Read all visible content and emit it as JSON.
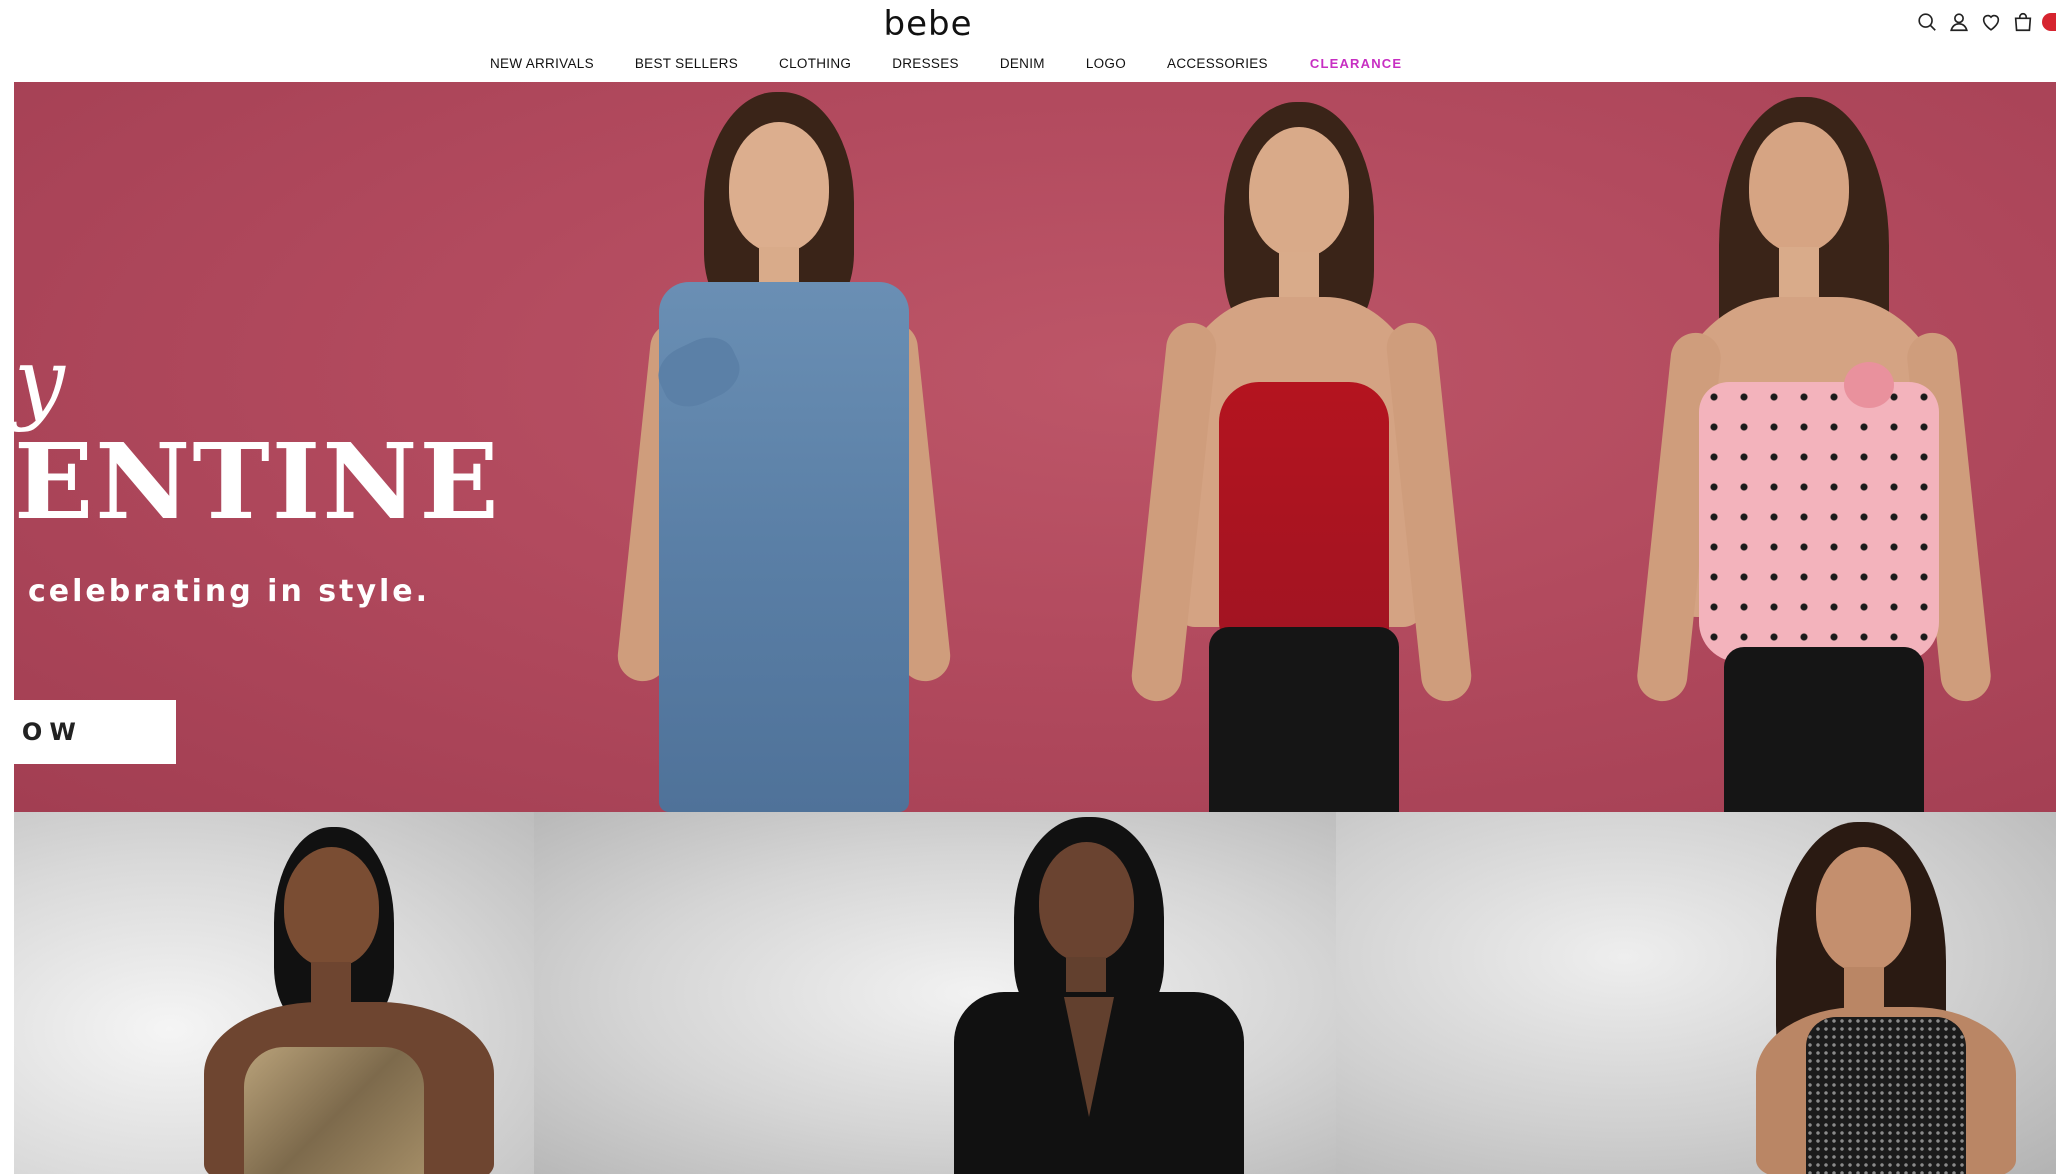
{
  "brand": {
    "logo_text": "bebe"
  },
  "header": {
    "icons": [
      "search-icon",
      "account-icon",
      "wishlist-heart-icon",
      "shopping-bag-icon"
    ],
    "accent_color": "#c72ec2",
    "badge_color": "#d6242f"
  },
  "nav": {
    "items": [
      {
        "label": "NEW ARRIVALS"
      },
      {
        "label": "BEST SELLERS"
      },
      {
        "label": "CLOTHING"
      },
      {
        "label": "DRESSES"
      },
      {
        "label": "DENIM"
      },
      {
        "label": "LOGO"
      },
      {
        "label": "ACCESSORIES"
      },
      {
        "label": "CLEARANCE"
      }
    ]
  },
  "hero": {
    "script_text": "y",
    "title": "ENTINE",
    "subtitle": "celebrating in style.",
    "cta_label": "IOW",
    "background_color": "#b24a5e"
  }
}
